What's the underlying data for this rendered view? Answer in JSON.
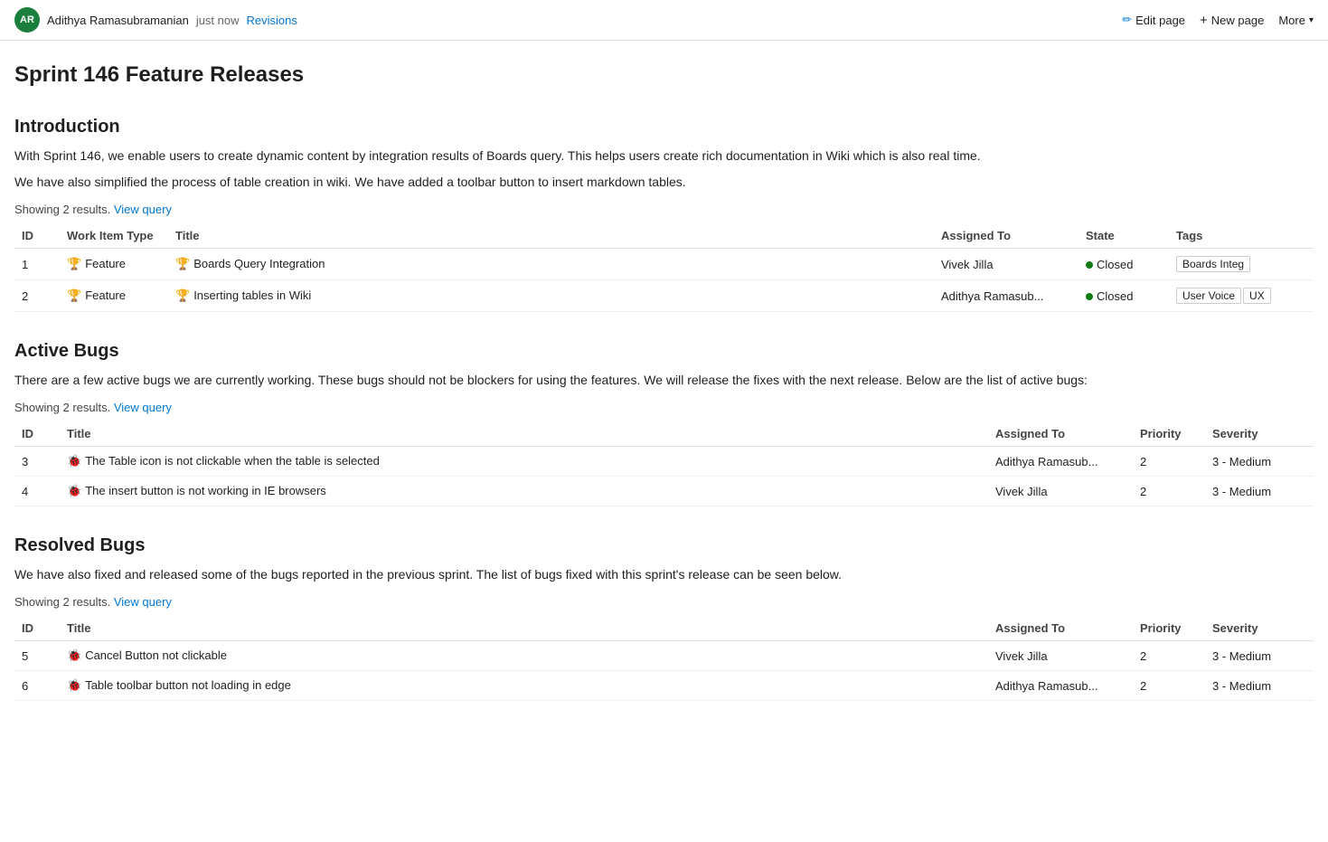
{
  "page": {
    "title": "Sprint 146 Feature Releases"
  },
  "header": {
    "avatar_initials": "AR",
    "author": "Adithya Ramasubramanian",
    "timestamp": "just now",
    "revisions_label": "Revisions",
    "edit_label": "Edit page",
    "new_label": "New page",
    "more_label": "More"
  },
  "introduction": {
    "section_title": "Introduction",
    "paragraphs": [
      "With Sprint 146, we enable users to create dynamic content by integration results of Boards query. This helps users create rich documentation in Wiki which is also real time.",
      "We have also simplified the process of table creation in wiki. We have added a toolbar button to insert markdown tables."
    ],
    "showing_text": "Showing 2 results.",
    "view_query_label": "View query",
    "table": {
      "columns": [
        "ID",
        "Work Item Type",
        "Title",
        "Assigned To",
        "State",
        "Tags"
      ],
      "rows": [
        {
          "id": "1",
          "type": "Feature",
          "type_icon": "🏆",
          "title": "Boards Query Integration",
          "assigned_to": "Vivek Jilla",
          "state": "Closed",
          "tags": [
            "Boards Integ"
          ]
        },
        {
          "id": "2",
          "type": "Feature",
          "type_icon": "🏆",
          "title": "Inserting tables in Wiki",
          "assigned_to": "Adithya Ramasub...",
          "state": "Closed",
          "tags": [
            "User Voice",
            "UX"
          ]
        }
      ]
    }
  },
  "active_bugs": {
    "section_title": "Active Bugs",
    "paragraph": "There are a few active bugs we are currently working. These bugs should not be blockers for using the features. We will release the fixes with the next release. Below are the list of active bugs:",
    "showing_text": "Showing 2 results.",
    "view_query_label": "View query",
    "table": {
      "columns": [
        "ID",
        "Title",
        "Assigned To",
        "Priority",
        "Severity"
      ],
      "rows": [
        {
          "id": "3",
          "title": "The Table icon is not clickable when the table is selected",
          "assigned_to": "Adithya Ramasub...",
          "priority": "2",
          "severity": "3 - Medium"
        },
        {
          "id": "4",
          "title": "The insert button is not working in IE browsers",
          "assigned_to": "Vivek Jilla",
          "priority": "2",
          "severity": "3 - Medium"
        }
      ]
    }
  },
  "resolved_bugs": {
    "section_title": "Resolved Bugs",
    "paragraph": "We have also fixed and released some of the bugs reported in the previous sprint. The list of bugs fixed with this sprint's release can be seen below.",
    "showing_text": "Showing 2 results.",
    "view_query_label": "View query",
    "table": {
      "columns": [
        "ID",
        "Title",
        "Assigned To",
        "Priority",
        "Severity"
      ],
      "rows": [
        {
          "id": "5",
          "title": "Cancel Button not clickable",
          "assigned_to": "Vivek Jilla",
          "priority": "2",
          "severity": "3 - Medium"
        },
        {
          "id": "6",
          "title": "Table toolbar button not loading in edge",
          "assigned_to": "Adithya Ramasub...",
          "priority": "2",
          "severity": "3 - Medium"
        }
      ]
    }
  },
  "colors": {
    "closed_dot": "#107c10",
    "link": "#0078d4"
  }
}
